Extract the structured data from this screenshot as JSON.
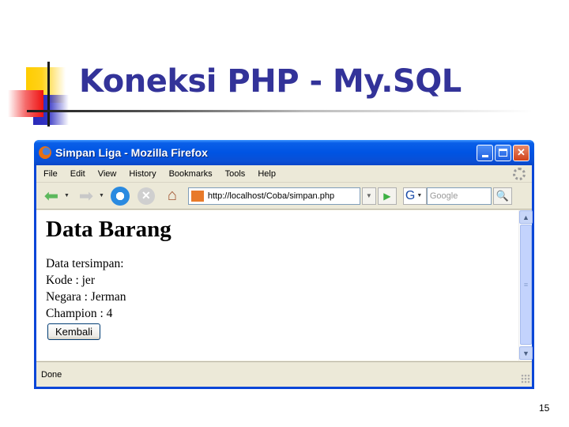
{
  "slide": {
    "title": "Koneksi PHP - My.SQL",
    "page_number": "15"
  },
  "window": {
    "title": "Simpan Liga - Mozilla Firefox",
    "controls": {
      "minimize": "minimize",
      "maximize": "maximize",
      "close": "✕"
    }
  },
  "menu": {
    "items": [
      "File",
      "Edit",
      "View",
      "History",
      "Bookmarks",
      "Tools",
      "Help"
    ]
  },
  "nav": {
    "url": "http://localhost/Coba/simpan.php",
    "search_placeholder": "Google",
    "search_engine_glyph": "G"
  },
  "icons": {
    "back": "⬅",
    "forward": "➡",
    "stop": "✕",
    "home": "⌂",
    "go": "▶",
    "search": "🔍",
    "dropdown": "▼",
    "scroll_up": "▲",
    "scroll_down": "▼",
    "thumb_grip": "≡"
  },
  "page": {
    "heading": "Data Barang",
    "lines": [
      "Data tersimpan:",
      "Kode : jer",
      "Negara : Jerman",
      "Champion : 4"
    ],
    "button_label": "Kembali"
  },
  "status": {
    "text": "Done"
  }
}
